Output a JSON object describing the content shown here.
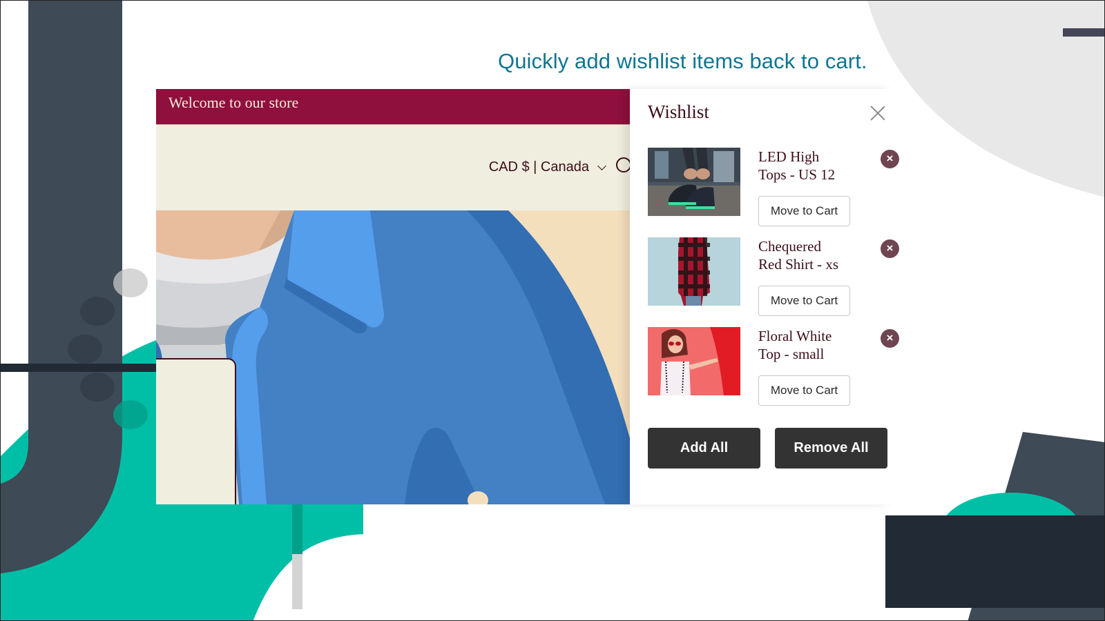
{
  "headline": "Quickly add wishlist items back to cart.",
  "store": {
    "announcement": "Welcome to our store",
    "country_selector": "CAD $ | Canada",
    "icons": {
      "country_chevron": "chevron-down-icon",
      "search": "search-icon"
    }
  },
  "wishlist": {
    "title": "Wishlist",
    "close_icon": "close-icon",
    "items": [
      {
        "name": "LED High Tops - US 12",
        "image": "black LED sneakers being laced",
        "action": "Move to Cart",
        "remove_icon": "remove-circle-icon"
      },
      {
        "name": "Chequered Red Shirt - xs",
        "image": "man in red plaid flannel shirt",
        "action": "Move to Cart",
        "remove_icon": "remove-circle-icon"
      },
      {
        "name": "Floral White Top - small",
        "image": "woman in white top against red wall",
        "action": "Move to Cart",
        "remove_icon": "remove-circle-icon"
      }
    ],
    "add_all": "Add All",
    "remove_all": "Remove All"
  },
  "colors": {
    "headline": "#0e7694",
    "announcement_bar": "#8f0f3d",
    "header_bg": "#f0eedf",
    "text_dark": "#3b0e18",
    "remove_badge": "#6e4551",
    "bulk_button": "#333333",
    "teal_accent": "#00bfa6",
    "slate": "#3e4a56"
  }
}
